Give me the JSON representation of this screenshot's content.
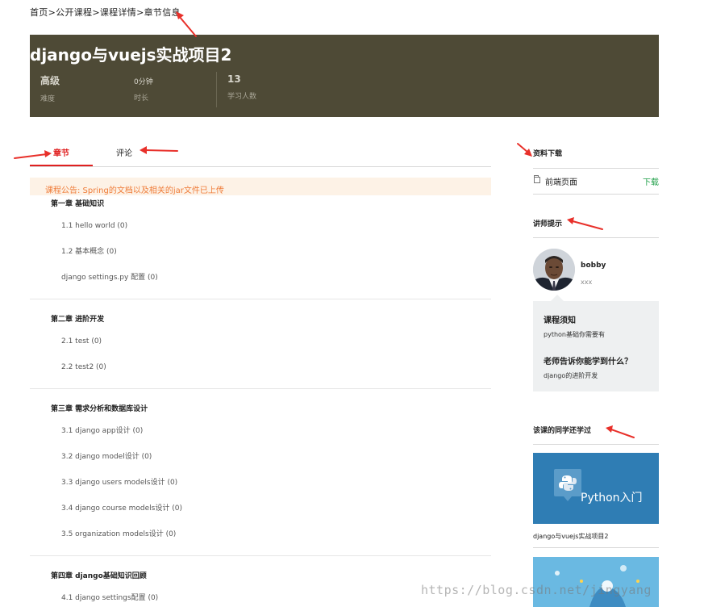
{
  "breadcrumb": {
    "home": "首页",
    "public_courses": "公开课程",
    "course_detail": "课程详情",
    "current": "章节信息",
    "separator": ">"
  },
  "banner": {
    "title": "django与vuejs实战项目2",
    "stats": [
      {
        "value": "高级",
        "label": "难度"
      },
      {
        "value": "0分钟",
        "label": "时长"
      },
      {
        "value": "13",
        "label": "学习人数"
      }
    ]
  },
  "tabs": {
    "chapters": "章节",
    "comments": "评论"
  },
  "notice": "课程公告: Spring的文档以及相关的jar文件已上传",
  "chapters": [
    {
      "title": "第一章 基础知识",
      "lessons": [
        "1.1 hello world (0)",
        "1.2 基本概念 (0)",
        "django settings.py 配置 (0)"
      ]
    },
    {
      "title": "第二章 进阶开发",
      "lessons": [
        "2.1 test (0)",
        "2.2 test2 (0)"
      ]
    },
    {
      "title": "第三章 需求分析和数据库设计",
      "lessons": [
        "3.1 django app设计 (0)",
        "3.2 django model设计 (0)",
        "3.3 django users models设计 (0)",
        "3.4 django course models设计 (0)",
        "3.5 organization models设计 (0)"
      ]
    },
    {
      "title": "第四章 django基础知识回顾",
      "lessons": [
        "4.1 django settings配置 (0)"
      ]
    }
  ],
  "sidebar": {
    "downloads": {
      "title": "资料下载",
      "items": [
        {
          "name": "前端页面",
          "action": "下载"
        }
      ]
    },
    "teacher": {
      "title": "讲师提示",
      "name": "bobby",
      "subtitle": "xxx",
      "notes_title": "课程须知",
      "notes": "python基础你需要有",
      "learn_title": "老师告诉你能学到什么？",
      "learn": "django的进阶开发"
    },
    "related": {
      "title": "该课的同学还学过",
      "card_caption": "Python入门",
      "course_name": "django与vuejs实战项目2"
    }
  },
  "watermark": "https://blog.csdn.net/jingyang",
  "colors": {
    "banner_bg": "#4e4a36",
    "active_tab": "#e02020",
    "notice_text": "#ef7c39",
    "notice_bg": "#fdf2e6",
    "download_link": "#21a04a",
    "annotation_arrow": "#e8302a"
  }
}
